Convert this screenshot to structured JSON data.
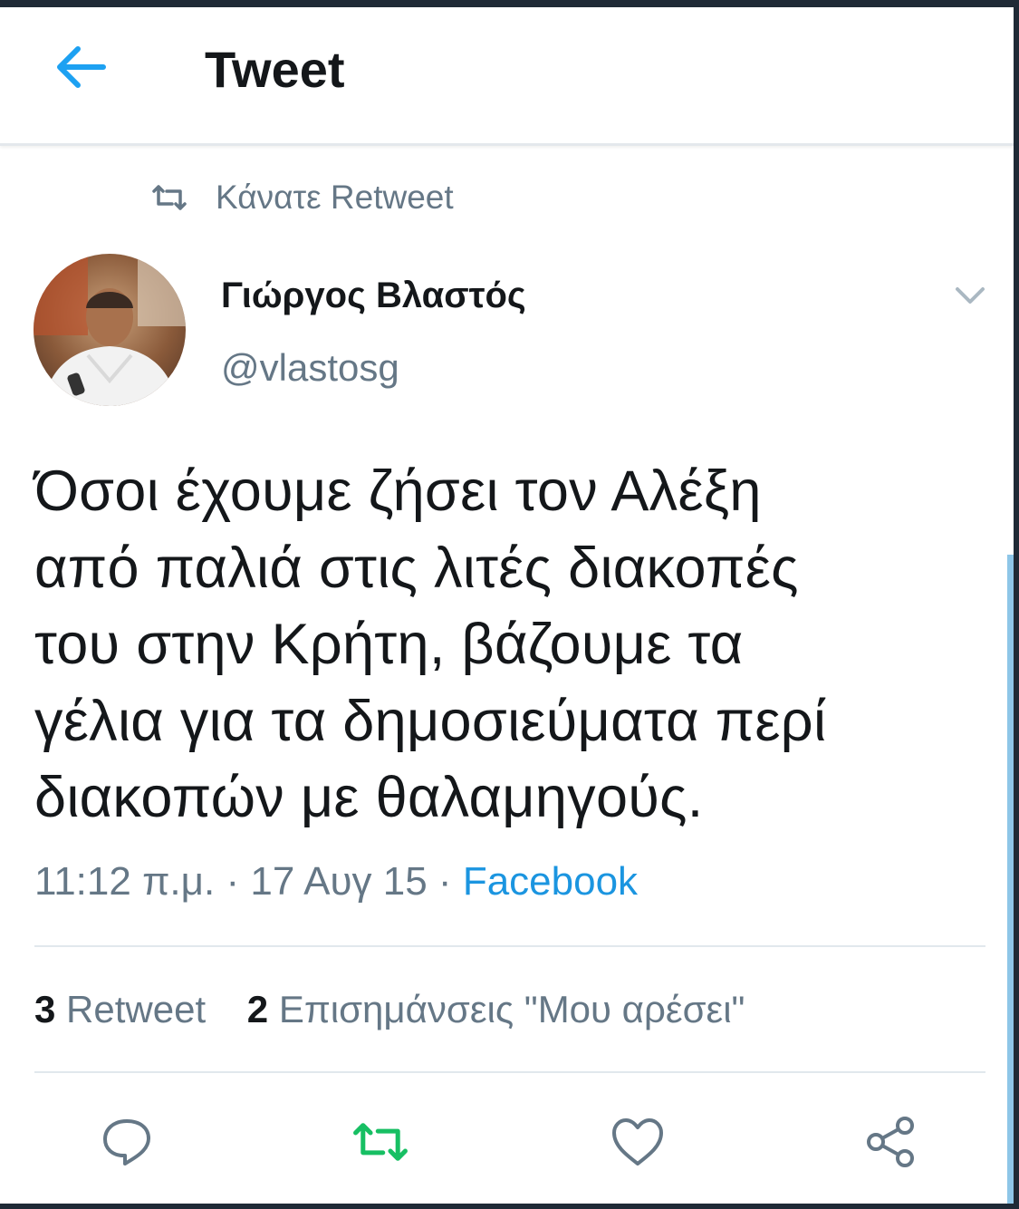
{
  "appbar": {
    "title": "Tweet",
    "back_icon": "arrow-left-icon",
    "accent_color": "#1da1f2"
  },
  "retweet_context": {
    "icon": "retweet-icon",
    "label": "Κάνατε Retweet"
  },
  "author": {
    "name": "Γιώργος Βλαστός",
    "handle": "@vlastosg",
    "avatar": "profile-photo"
  },
  "tweet": {
    "text": "Όσοι έχουμε ζήσει τον Αλέξη\nαπό παλιά στις λιτές διακοπές\nτου στην Κρήτη, βάζουμε τα\nγέλια για τα δημοσιεύματα περί\nδιακοπών με θαλαμηγούς.",
    "time": "11:12 π.μ.",
    "date": "17 Αυγ 15",
    "source": "Facebook",
    "separator": "·"
  },
  "stats": {
    "retweets_count": "3",
    "retweets_label": "Retweet",
    "likes_count": "2",
    "likes_label": "Επισημάνσεις \"Μου αρέσει\""
  },
  "actions": {
    "reply_icon": "reply-icon",
    "retweet_icon": "retweet-icon",
    "like_icon": "heart-icon",
    "share_icon": "share-icon",
    "retweet_active_color": "#17bf63",
    "icon_color": "#657786"
  },
  "colors": {
    "text_primary": "#14171a",
    "text_secondary": "#657786",
    "link": "#1b95e0",
    "divider": "#e1e8ed"
  }
}
